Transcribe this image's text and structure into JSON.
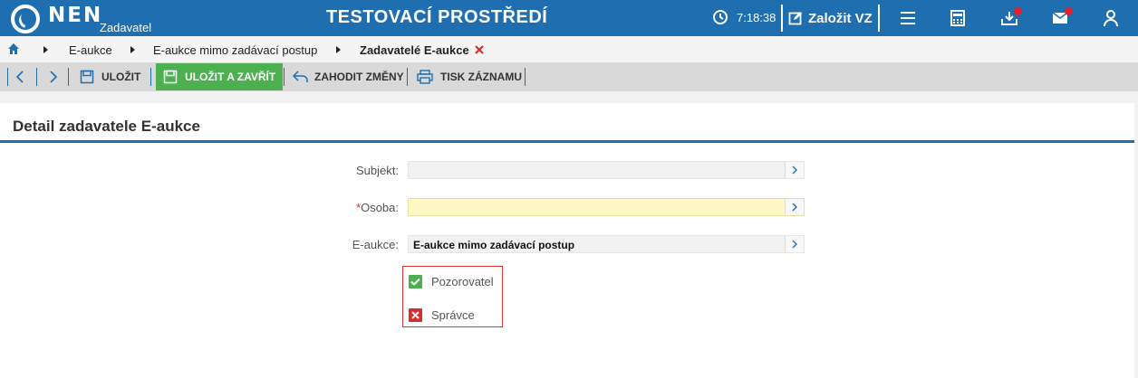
{
  "header": {
    "logo_text": "NEN",
    "logo_sub": "Zadavatel",
    "env_title": "TESTOVACÍ PROSTŘEDÍ",
    "time": "7:18:38",
    "new_vz_label": "Založit VZ",
    "icons": [
      "clock-icon",
      "edit-icon",
      "menu-icon",
      "calculator-icon",
      "inbox-icon",
      "mail-icon",
      "user-icon"
    ],
    "notification_color": "#e0202a",
    "brand_color": "#1f6fb0"
  },
  "breadcrumb": {
    "items": [
      "E-aukce",
      "E-aukce mimo zadávací postup",
      "Zadavatelé E-aukce"
    ]
  },
  "toolbar": {
    "save_label": "ULOŽIT",
    "save_close_label": "ULOŽIT A ZAVŘÍT",
    "discard_label": "ZAHODIT ZMĚNY",
    "print_label": "TISK ZÁZNAMU"
  },
  "detail": {
    "title": "Detail zadavatele E-aukce",
    "fields": {
      "subjekt": {
        "label": "Subjekt:",
        "value": ""
      },
      "osoba": {
        "label": "Osoba:",
        "required_mark": "*",
        "value": ""
      },
      "eaukce": {
        "label": "E-aukce:",
        "value": "E-aukce mimo zadávací postup"
      }
    },
    "checkboxes": {
      "pozorovatel": {
        "label": "Pozorovatel",
        "checked": true
      },
      "spravce": {
        "label": "Správce",
        "checked": false
      }
    }
  }
}
